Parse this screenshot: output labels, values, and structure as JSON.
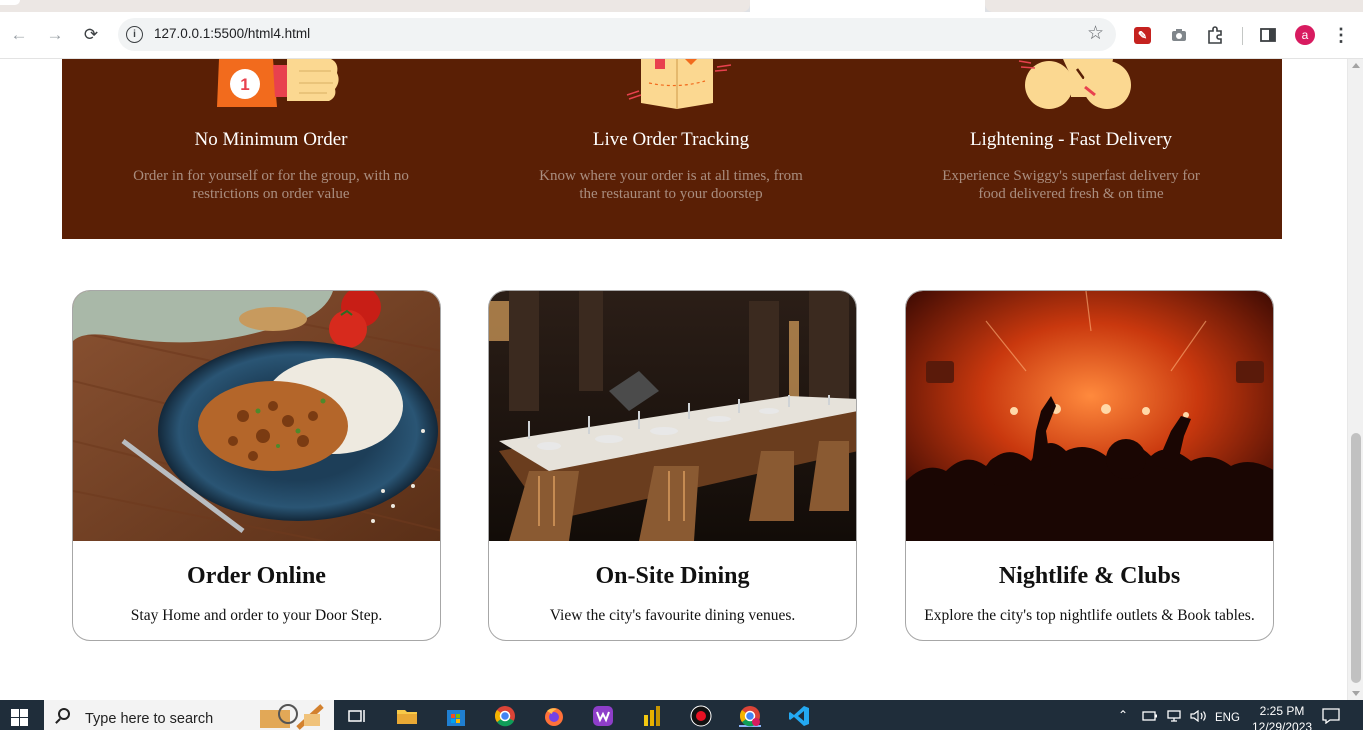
{
  "browser": {
    "url": "127.0.0.1:5500/html4.html",
    "profile_initial": "a",
    "icons": [
      "back-icon",
      "forward-icon",
      "reload-icon",
      "site-info-icon",
      "bookmark-star-icon",
      "pdf-extension-icon",
      "camera-icon",
      "extensions-puzzle-icon",
      "side-panel-icon",
      "menu-kebab-icon"
    ]
  },
  "features": [
    {
      "badge": "1",
      "title": "No Minimum Order",
      "desc": "Order in for yourself or for the group, with no restrictions on order value"
    },
    {
      "title": "Live Order Tracking",
      "desc": "Know where your order is at all times, from the restaurant to your doorstep"
    },
    {
      "title": "Lightening - Fast Delivery",
      "desc": "Experience Swiggy's superfast delivery for food delivered fresh & on time"
    }
  ],
  "cards": [
    {
      "title": "Order Online",
      "desc": "Stay Home and order to your Door Step."
    },
    {
      "title": "On-Site Dining",
      "desc": "View the city's favourite dining venues."
    },
    {
      "title": "Nightlife & Clubs",
      "desc": "Explore the city's top nightlife outlets & Book tables."
    }
  ],
  "taskbar": {
    "search_placeholder": "Type here to search",
    "language": "ENG",
    "time": "2:25 PM",
    "date": "12/29/2023"
  },
  "colors": {
    "feature_band": "#5a1f05",
    "taskbar": "#1f2d3a",
    "avatar": "#d81b60"
  }
}
